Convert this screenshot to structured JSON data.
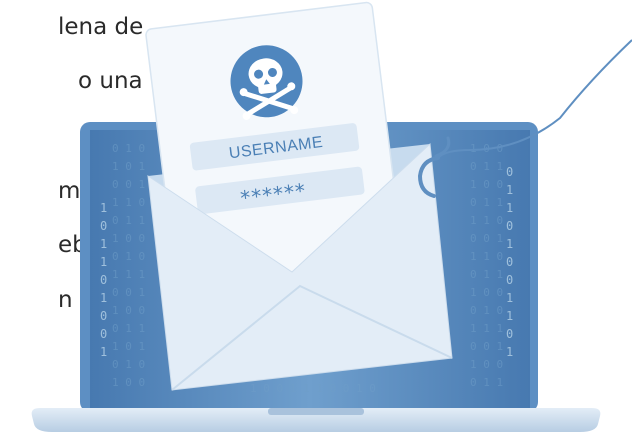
{
  "text_fragments": [
    "lena de",
    "o una",
    "ma",
    "eba",
    "n la"
  ],
  "form": {
    "username_label": "USERNAME",
    "password_mask": "******"
  },
  "binary_stream": [
    "0",
    "1",
    "1",
    "0",
    "1",
    "0",
    "0",
    "1",
    "1",
    "1",
    "0",
    "1",
    "0",
    "0",
    "1",
    "0",
    "1",
    "1",
    "0",
    "1"
  ],
  "icons": {
    "skull": "skull-crossbones-icon",
    "hook": "fishing-hook-icon"
  },
  "colors": {
    "screen": "#4d86bf",
    "screen_light": "#6a9bcc",
    "frame": "#6f9fce",
    "base": "#cfe0ef",
    "paper": "#eef4fa",
    "envelope": "#dde9f4",
    "skull_bg": "#4f86be",
    "text_accent": "#4a7fb5"
  }
}
